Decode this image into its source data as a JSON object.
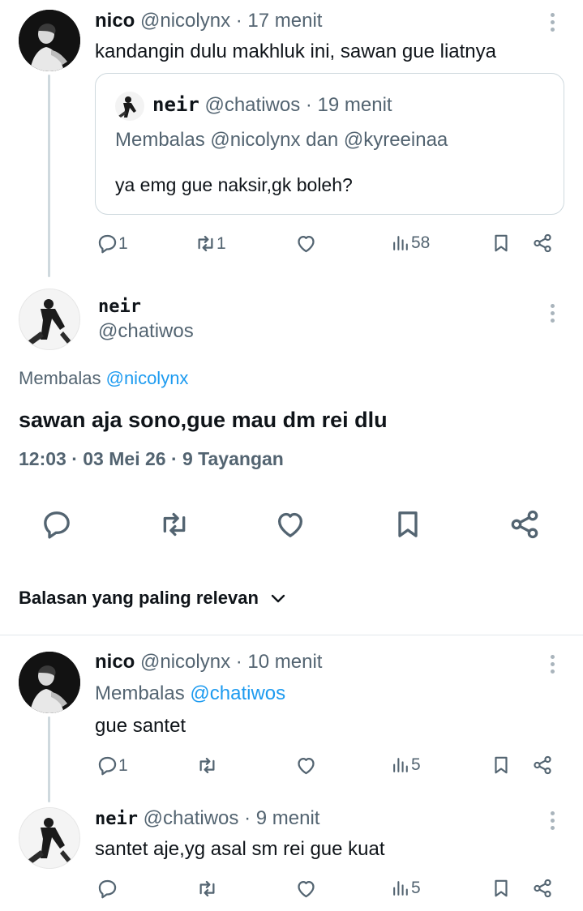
{
  "tweet1": {
    "name": "nico",
    "handle": "@nicolynx",
    "time": "· 17 menit",
    "text": "kandangin dulu makhluk ini, sawan gue liatnya",
    "quote": {
      "name": "neir",
      "handle": "@chatiwos",
      "time": "· 19 menit",
      "reply_prefix": "Membalas",
      "reply_to": "@nicolynx dan @kyreeinaa",
      "text": "ya emg gue naksir,gk boleh?"
    },
    "actions": {
      "replies": "1",
      "reposts": "1",
      "views": "58"
    }
  },
  "main_tweet": {
    "name": "neir",
    "handle": "@chatiwos",
    "reply_prefix": "Membalas",
    "reply_to": "@nicolynx",
    "text": "sawan aja sono,gue mau dm rei dlu",
    "meta": "12:03 · 03 Mei 26 · 9 Tayangan"
  },
  "sort": {
    "label": "Balasan yang paling relevan"
  },
  "reply1": {
    "name": "nico",
    "handle": "@nicolynx",
    "time": "· 10 menit",
    "reply_prefix": "Membalas",
    "reply_to": "@chatiwos",
    "text": "gue santet",
    "actions": {
      "replies": "1",
      "views": "5"
    }
  },
  "reply2": {
    "name": "neir",
    "handle": "@chatiwos",
    "time": "· 9 menit",
    "text": "santet aje,yg asal sm rei gue kuat",
    "actions": {
      "views": "5"
    }
  },
  "icons": [
    "reply-icon",
    "repost-icon",
    "like-icon",
    "views-icon",
    "bookmark-icon",
    "share-icon",
    "more-icon",
    "chevron-down-icon"
  ],
  "colors": {
    "link": "#1d9bf0",
    "secondary_text": "#536471",
    "thread_line": "#cfd9de"
  }
}
